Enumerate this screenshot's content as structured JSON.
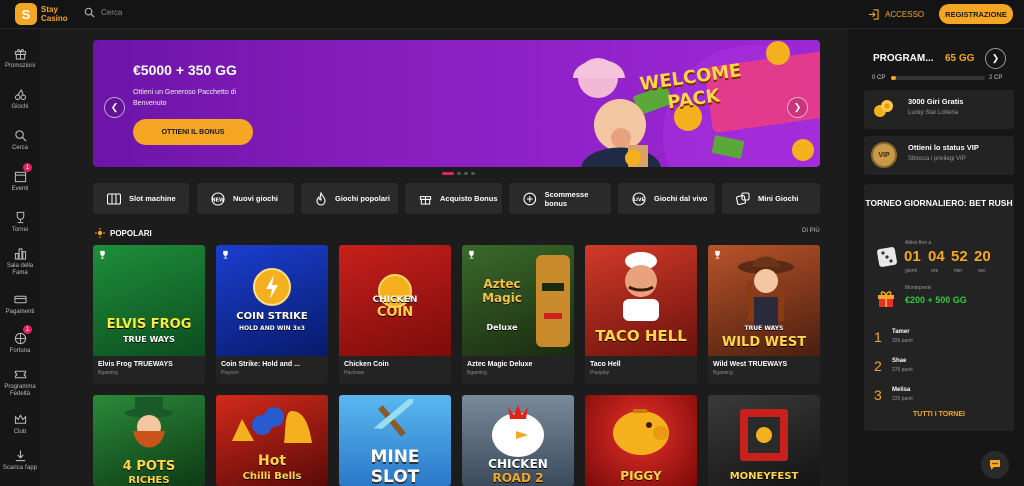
{
  "header": {
    "logo_mark": "S",
    "logo_line1": "Stay",
    "logo_line2": "Casino",
    "search_placeholder": "Cerca",
    "login_label": "ACCESSO",
    "register_label": "REGISTRAZIONE"
  },
  "sidebar": {
    "items": [
      {
        "label": "Promozioni",
        "icon": "gift-icon"
      },
      {
        "label": "Giochi",
        "icon": "cherries-icon"
      },
      {
        "label": "Cerca",
        "icon": "search-icon"
      },
      {
        "label": "Eventi",
        "icon": "calendar-icon",
        "badge": "1"
      },
      {
        "label": "Tornei",
        "icon": "trophy-icon"
      },
      {
        "label": "Sala della Fama",
        "icon": "chart-icon"
      },
      {
        "label": "Pagamenti",
        "icon": "card-icon"
      },
      {
        "label": "Fortuna",
        "icon": "wheel-icon",
        "badge": "1"
      },
      {
        "label": "Programma Fedeltà",
        "icon": "ticket-icon"
      },
      {
        "label": "Club",
        "icon": "crown-icon"
      },
      {
        "label": "Scarica l'app",
        "icon": "download-icon"
      }
    ]
  },
  "banner": {
    "title": "€5000 + 350 GG",
    "subtitle": "Ottieni un Generoso Pacchetto di Benvenuto",
    "button": "OTTIENI IL BONUS",
    "art_line1": "WELCOME",
    "art_line2": "PACK",
    "colors": {
      "start": "#6d14a8",
      "end": "#9c27d6"
    }
  },
  "categories": [
    {
      "label": "Slot machine",
      "icon": "slot-icon"
    },
    {
      "label": "Nuovi giochi",
      "icon": "new-icon"
    },
    {
      "label": "Giochi popolari",
      "icon": "fire-icon"
    },
    {
      "label": "Acquisto Bonus",
      "icon": "gift-icon"
    },
    {
      "label": "Scommesse bonus",
      "icon": "bonus-bet-icon"
    },
    {
      "label": "Giochi dal vivo",
      "icon": "live-icon"
    },
    {
      "label": "Mini Giochi",
      "icon": "dice-icon"
    }
  ],
  "popular": {
    "title": "POPOLARI",
    "more": "DI PIÙ",
    "games": [
      {
        "title": "Elvis Frog TRUEWAYS",
        "provider": "Bgaming",
        "art_line1": "ELVIS FROG",
        "art_line2": "TRUE WAYS",
        "color1": "#1e8f3a",
        "color2": "#0c4d1f"
      },
      {
        "title": "Coin Strike: Hold and ...",
        "provider": "Playson",
        "art_line1": "COIN STRIKE",
        "art_line2": "HOLD AND WIN 3x3",
        "color1": "#1a3fd0",
        "color2": "#081a6a"
      },
      {
        "title": "Chicken Coin",
        "provider": "Hacksaw",
        "art_line1": "CHICKEN",
        "art_line2": "COIN",
        "color1": "#c8201c",
        "color2": "#7a0c0a"
      },
      {
        "title": "Aztec Magic Deluxe",
        "provider": "Bgaming",
        "art_line1": "Aztec Magic",
        "art_line2": "Deluxe",
        "color1": "#3a6a2a",
        "color2": "#1a2a10"
      },
      {
        "title": "Taco Hell",
        "provider": "Popiplay",
        "art_line1": "TACO",
        "art_line2": "HELL",
        "color1": "#d23a2a",
        "color2": "#6a120c"
      },
      {
        "title": "Wild West TRUEWAYS",
        "provider": "Bgaming",
        "art_line1": "TRUE WAYS",
        "art_line2": "WILD WEST",
        "color1": "#b8542a",
        "color2": "#4a1e0e"
      }
    ],
    "games_row2": [
      {
        "art_line1": "4 POTS",
        "art_line2": "RICHES",
        "color1": "#2a8a3a",
        "color2": "#0e3a14"
      },
      {
        "art_line1": "Hot",
        "art_line2": "Chilli Bells",
        "color1": "#d22a1a",
        "color2": "#5a0a08"
      },
      {
        "art_line1": "MINE",
        "art_line2": "SLOT",
        "color1": "#5ab8f0",
        "color2": "#2a78c8"
      },
      {
        "art_line1": "CHICKEN",
        "art_line2": "ROAD 2",
        "color1": "#7a8a9a",
        "color2": "#3a4a5a"
      },
      {
        "art_line1": "PIGGY",
        "art_line2": "",
        "color1": "#e8302a",
        "color2": "#7a0a08"
      },
      {
        "art_line1": "MONEYFEST",
        "art_line2": "",
        "color1": "#3a3a3a",
        "color2": "#141414"
      }
    ]
  },
  "loyalty": {
    "title": "PROGRAM...",
    "value": "65 GG",
    "min": "0 CP",
    "max": "2 CP",
    "progress": 0.05
  },
  "offers": [
    {
      "title": "3000 Giri Gratis",
      "subtitle": "Lucky Star Lotteria",
      "icon": "spins-icon"
    },
    {
      "title": "Ottieni lo status VIP",
      "subtitle": "Sblocca i privilegi VIP",
      "icon_text": "VIP"
    }
  ],
  "tournament": {
    "title": "TORNEO GIORNALIERO: BET RUSH",
    "active_label": "Attivo fino a",
    "countdown": [
      {
        "value": "01",
        "unit": "giorni"
      },
      {
        "value": "04",
        "unit": "ore"
      },
      {
        "value": "52",
        "unit": "min"
      },
      {
        "value": "20",
        "unit": "sec"
      }
    ],
    "prize_label": "Montepremi",
    "prize": "€200 + 500 GG",
    "leaders": [
      {
        "rank": "1",
        "name": "Tamer",
        "points": "326 punti"
      },
      {
        "rank": "2",
        "name": "Shae",
        "points": "276 punti"
      },
      {
        "rank": "3",
        "name": "Melisa",
        "points": "220 punti"
      }
    ],
    "all_link": "TUTTI I TORNEI"
  },
  "colors": {
    "accent": "#f5a623",
    "badge": "#e0245e",
    "prize": "#2ecc40"
  }
}
